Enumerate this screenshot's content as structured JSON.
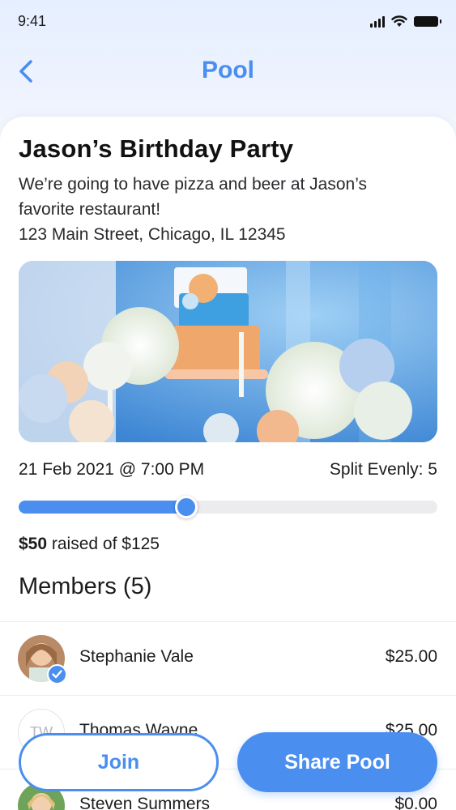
{
  "status_bar": {
    "time": "9:41"
  },
  "nav": {
    "title": "Pool"
  },
  "event": {
    "title": "Jason’s Birthday Party",
    "description": "We’re going to have pizza and beer at Jason’s favorite restaurant!",
    "address": "123 Main Street, Chicago, IL 12345",
    "date": "21 Feb 2021 @ 7:00 PM",
    "split": "Split Evenly: 5"
  },
  "progress": {
    "raised_amount": "$50",
    "raised_text": " raised of $125",
    "fraction": 0.4
  },
  "members": {
    "header": "Members (5)",
    "items": [
      {
        "name": "Stephanie Vale",
        "amount": "$25.00",
        "initials": "",
        "checked": true
      },
      {
        "name": "Thomas Wayne",
        "amount": "$25.00",
        "initials": "TW",
        "checked": false
      },
      {
        "name": "Steven Summers",
        "amount": "$0.00",
        "initials": "",
        "checked": false
      }
    ]
  },
  "actions": {
    "join_label": "Join",
    "share_label": "Share Pool"
  },
  "colors": {
    "accent": "#4a8ef0",
    "text": "#1c1c1e",
    "track": "#ececee"
  }
}
